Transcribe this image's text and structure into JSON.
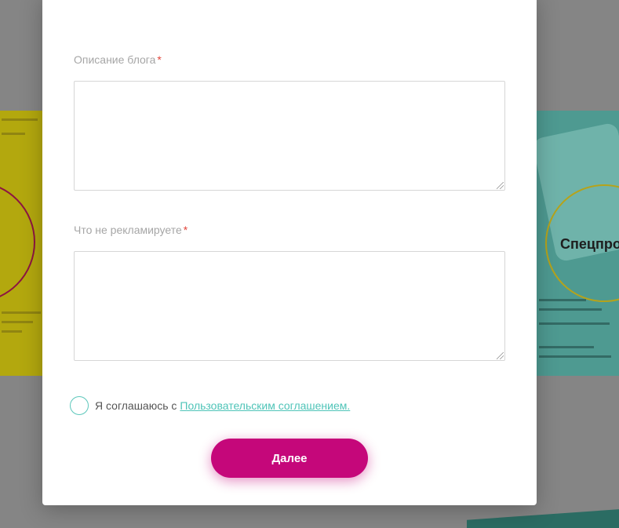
{
  "background": {
    "promo_text": "Спецпро"
  },
  "form": {
    "description_label": "Описание блога",
    "description_required": "*",
    "description_value": "",
    "not_advertise_label": "Что не рекламируете",
    "not_advertise_required": "*",
    "not_advertise_value": "",
    "agree_text": "Я соглашаюсь с",
    "agree_link": "Пользовательским соглашением.",
    "next_label": "Далее"
  },
  "colors": {
    "accent": "#c5077a",
    "link": "#4fc4b8",
    "required": "#e2453b"
  }
}
